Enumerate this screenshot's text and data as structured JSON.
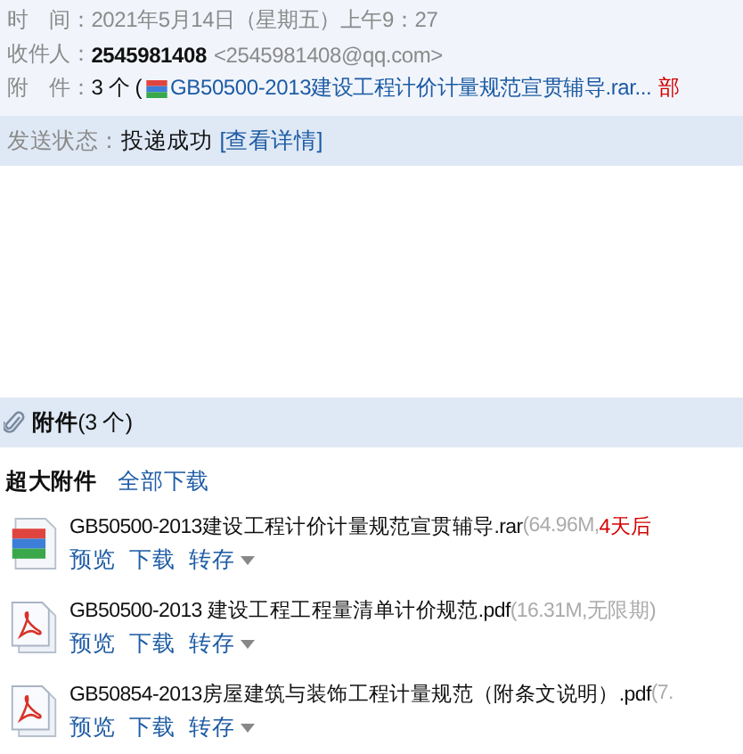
{
  "header": {
    "time_label": "时　间：",
    "time": "2021年5月14日（星期五）上午9：27",
    "recipient_label": "收件人：",
    "recipient_name": "2545981408",
    "recipient_email": "<2545981408@qq.com>",
    "attach_label": "附　件：",
    "attach_count": "3 个 (",
    "attach_first": "GB50500-2013建设工程计价计量规范宣贯辅导.rar...",
    "attach_more": "部"
  },
  "send_status": {
    "label": "发送状态：",
    "value": "投递成功",
    "details_link": "[查看详情]"
  },
  "attachments_bar": {
    "title": "附件",
    "count": "(3 个)"
  },
  "section": {
    "title": "超大附件",
    "download_all": "全部下载"
  },
  "files": [
    {
      "kind": "rar",
      "name": "GB50500-2013建设工程计价计量规范宣贯辅导.rar",
      "size": "(64.96M,",
      "expiry": "4天后",
      "actions": [
        "预览",
        "下载",
        "转存"
      ]
    },
    {
      "kind": "pdf",
      "name": "GB50500-2013 建设工程工程量清单计价规范.pdf",
      "size": "(16.31M,无限期)",
      "actions": [
        "预览",
        "下载",
        "转存"
      ]
    },
    {
      "kind": "pdf",
      "name": "GB50854-2013房屋建筑与装饰工程计量规范（附条文说明）.pdf",
      "size": "(7.",
      "actions": [
        "预览",
        "下载",
        "转存"
      ]
    }
  ]
}
